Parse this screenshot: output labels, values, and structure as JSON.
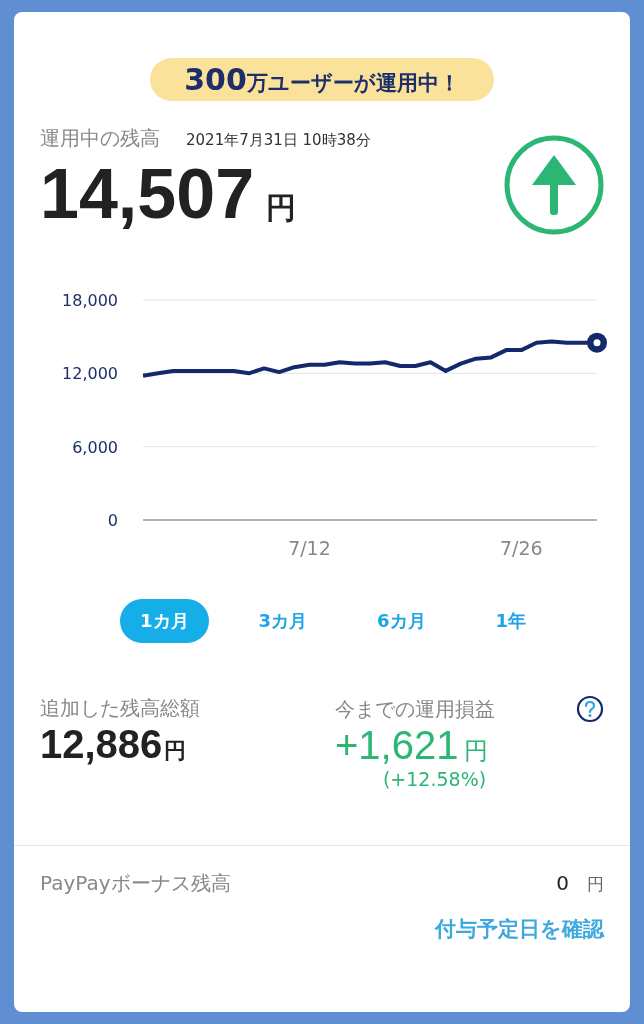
{
  "banner": {
    "count": "300",
    "text": "万ユーザーが運用中！"
  },
  "balance": {
    "label": "運用中の残高",
    "timestamp": "2021年7月31日 10時38分",
    "amount": "14,507",
    "unit": "円",
    "rising": true
  },
  "chart_data": {
    "type": "line",
    "categories": [
      null,
      null,
      null,
      null,
      null,
      null,
      null,
      null,
      null,
      null,
      null,
      "7/12",
      null,
      null,
      null,
      null,
      null,
      null,
      null,
      null,
      null,
      null,
      null,
      null,
      null,
      "7/26",
      null,
      null,
      null,
      null,
      null
    ],
    "ylim": [
      0,
      18000
    ],
    "yticks": [
      {
        "value": 0,
        "label": "0"
      },
      {
        "value": 6000,
        "label": "6,000"
      },
      {
        "value": 12000,
        "label": "12,000"
      },
      {
        "value": 18000,
        "label": "18,000"
      }
    ],
    "series": [
      {
        "color": "#13296b",
        "values": [
          11800,
          12000,
          12200,
          12200,
          12200,
          12200,
          12200,
          12000,
          12400,
          12100,
          12500,
          12700,
          12700,
          12900,
          12800,
          12800,
          12900,
          12600,
          12600,
          12900,
          12200,
          12800,
          13200,
          13300,
          13900,
          13900,
          14500,
          14600,
          14500,
          14500,
          14507
        ]
      }
    ]
  },
  "periods": [
    {
      "label": "1カ月",
      "selected": true
    },
    {
      "label": "3カ月",
      "selected": false
    },
    {
      "label": "6カ月",
      "selected": false
    },
    {
      "label": "1年",
      "selected": false
    }
  ],
  "deposited": {
    "label": "追加した残高総額",
    "amount": "12,886",
    "unit": "円"
  },
  "profit": {
    "label": "今までの運用損益",
    "amount": "+1,621",
    "unit": "円",
    "percent": "(+12.58%)",
    "rising": true
  },
  "bonus": {
    "label": "PayPayボーナス残高",
    "amount": "0",
    "unit": "円",
    "link": "付与予定日を確認"
  }
}
